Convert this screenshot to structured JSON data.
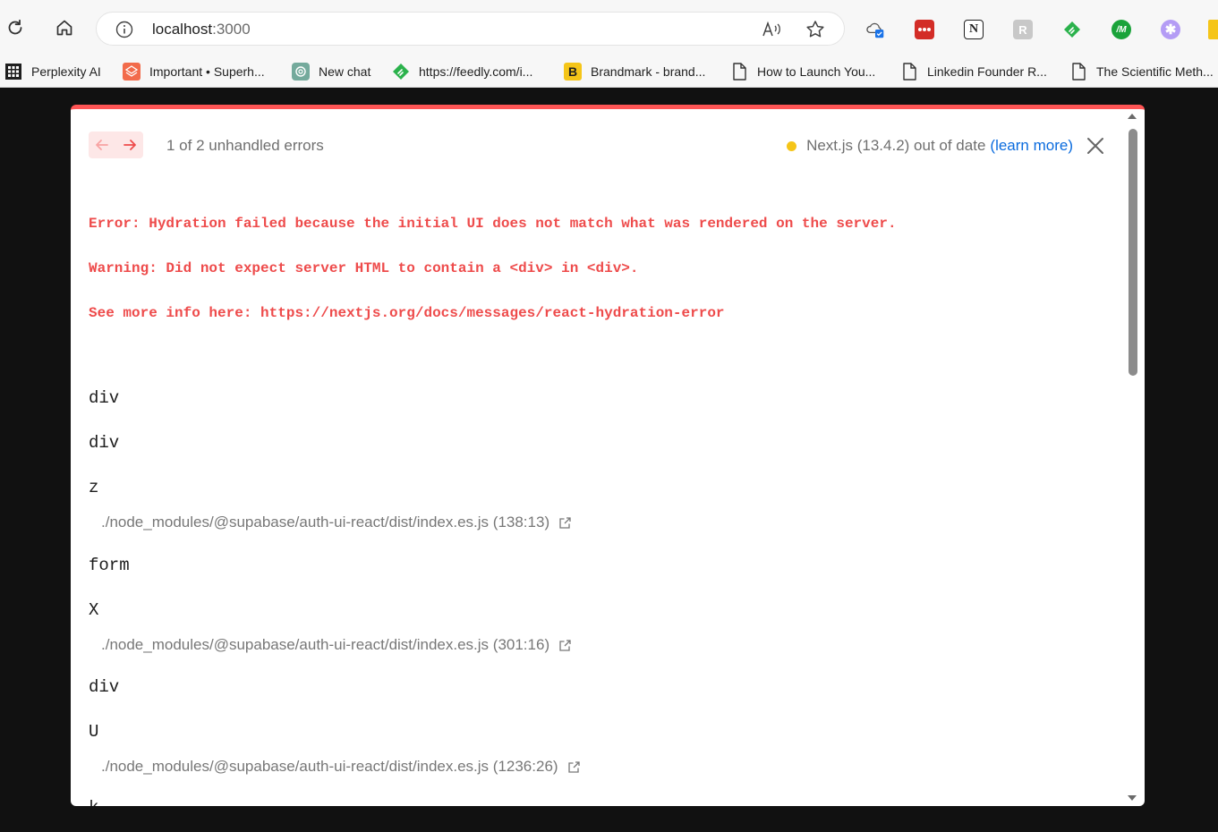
{
  "browser": {
    "url_host": "localhost",
    "url_port": ":3000",
    "icons": {
      "refresh": "refresh-icon",
      "home": "home-icon",
      "info": "info-icon",
      "read_aloud": "read-aloud-icon",
      "favorite": "star-icon"
    },
    "extensions": [
      {
        "name": "cloud-sync-extension-icon",
        "color": "#5a5a5a"
      },
      {
        "name": "lastpass-extension-icon",
        "color": "#d32d27"
      },
      {
        "name": "notion-extension-icon",
        "color": "#1f1f1f"
      },
      {
        "name": "extension-grey-icon",
        "color": "#c8c8c8"
      },
      {
        "name": "feedly-extension-icon",
        "color": "#2bb24c"
      },
      {
        "name": "extension-m-icon",
        "color": "#1aa33a"
      },
      {
        "name": "extension-asterisk-icon",
        "color": "#b49cf5"
      }
    ]
  },
  "bookmarks": [
    {
      "label": "Perplexity AI",
      "icon": "apps-grid-icon"
    },
    {
      "label": "Important • Superh...",
      "icon": "superhuman-icon"
    },
    {
      "label": "New chat",
      "icon": "openai-icon"
    },
    {
      "label": "https://feedly.com/i...",
      "icon": "feedly-icon"
    },
    {
      "label": "Brandmark - brand...",
      "icon": "brandmark-icon",
      "glyph": "B"
    },
    {
      "label": "How to Launch You...",
      "icon": "page-icon"
    },
    {
      "label": "Linkedin Founder R...",
      "icon": "page-icon"
    },
    {
      "label": "The Scientific Meth...",
      "icon": "page-icon"
    }
  ],
  "overlay": {
    "error_count": "1 of 2 unhandled errors",
    "version_text": "Next.js (13.4.2) out of date",
    "learn_more": "(learn more)",
    "accent": "#ff5555",
    "messages": [
      "Error: Hydration failed because the initial UI does not match what was rendered on the server.",
      "Warning: Did not expect server HTML to contain a <div> in <div>.",
      "See more info here: https://nextjs.org/docs/messages/react-hydration-error"
    ],
    "stack": [
      {
        "component": "div"
      },
      {
        "component": "div"
      },
      {
        "component": "z",
        "source": "./node_modules/@supabase/auth-ui-react/dist/index.es.js (138:13)"
      },
      {
        "component": "form"
      },
      {
        "component": "X",
        "source": "./node_modules/@supabase/auth-ui-react/dist/index.es.js (301:16)"
      },
      {
        "component": "div"
      },
      {
        "component": "U",
        "source": "./node_modules/@supabase/auth-ui-react/dist/index.es.js (1236:26)"
      },
      {
        "component": "k"
      }
    ]
  }
}
